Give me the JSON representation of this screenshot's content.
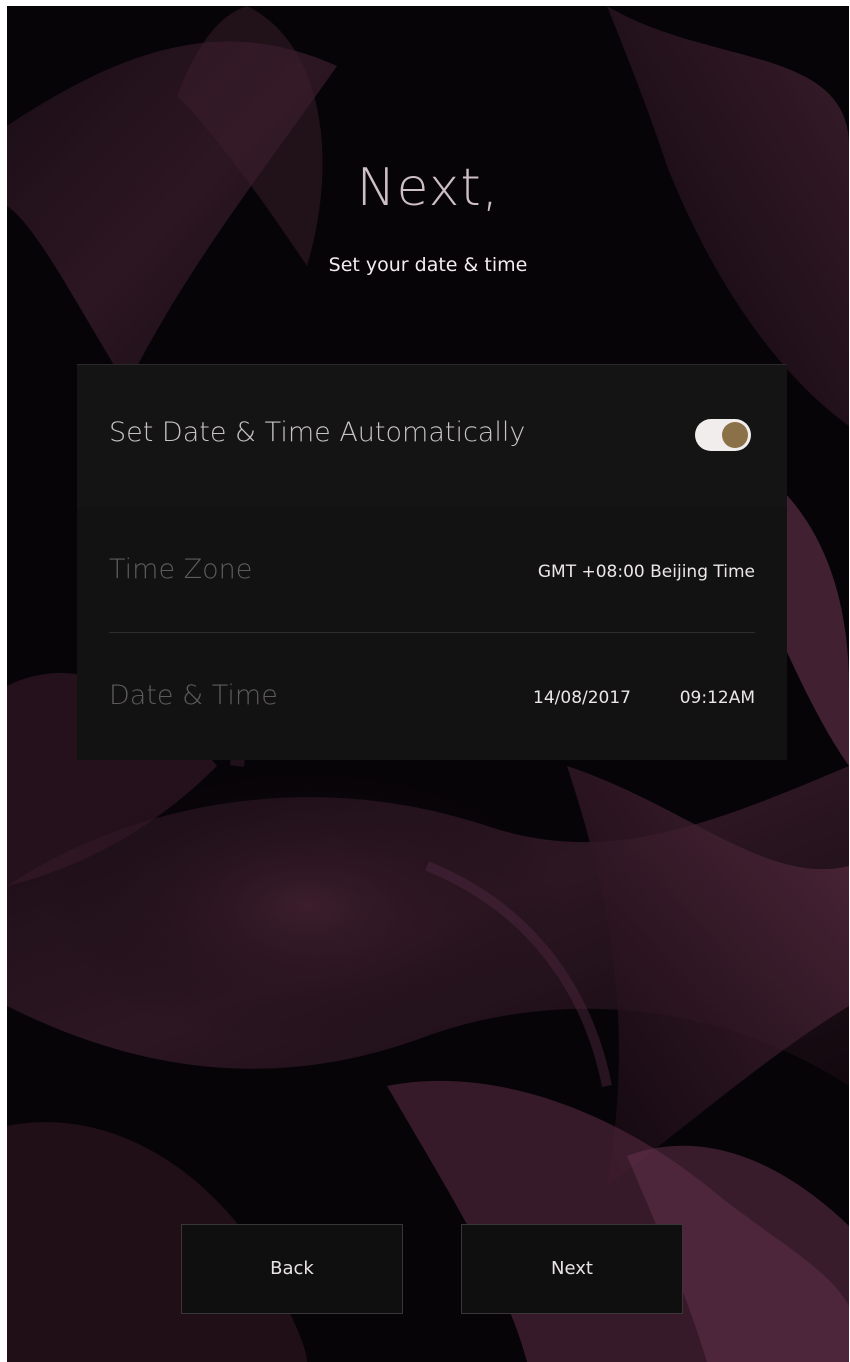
{
  "header": {
    "title": "Next,",
    "subtitle": "Set your date & time"
  },
  "settings": {
    "auto": {
      "label": "Set Date & Time Automatically",
      "enabled": true,
      "toggle_color": "#8b7147"
    },
    "time_zone": {
      "label": "Time Zone",
      "value": "GMT +08:00 Beijing Time"
    },
    "date_time": {
      "label": "Date & Time",
      "date": "14/08/2017",
      "time": "09:12AM"
    }
  },
  "footer": {
    "back_label": "Back",
    "next_label": "Next"
  },
  "colors": {
    "background": "#050305",
    "fabric": "#3a1b2b",
    "panel": "#121212",
    "accent": "#8b7147"
  }
}
